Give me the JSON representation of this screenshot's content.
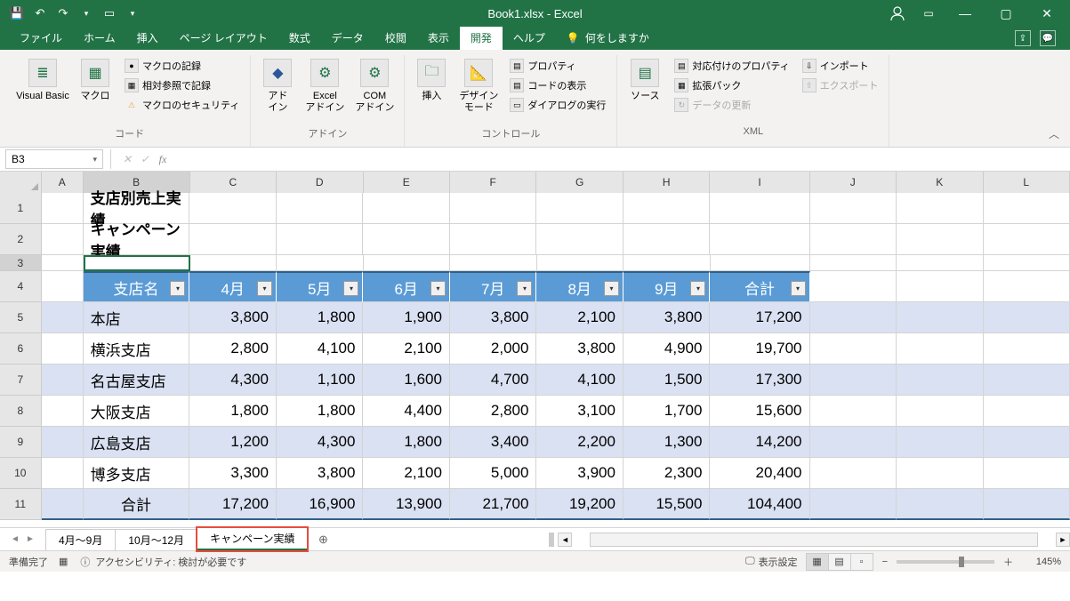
{
  "title": "Book1.xlsx - Excel",
  "tabs": [
    "ファイル",
    "ホーム",
    "挿入",
    "ページ レイアウト",
    "数式",
    "データ",
    "校閲",
    "表示",
    "開発",
    "ヘルプ"
  ],
  "active_tab_index": 8,
  "tell_me": "何をしますか",
  "ribbon": {
    "groups": [
      {
        "label": "コード",
        "big": [
          {
            "label": "Visual Basic"
          },
          {
            "label": "マクロ"
          }
        ],
        "small": [
          "マクロの記録",
          "相対参照で記録",
          "マクロのセキュリティ"
        ]
      },
      {
        "label": "アドイン",
        "big": [
          {
            "label": "アド\nイン"
          },
          {
            "label": "Excel\nアドイン"
          },
          {
            "label": "COM\nアドイン"
          }
        ],
        "small": []
      },
      {
        "label": "コントロール",
        "big": [
          {
            "label": "挿入"
          },
          {
            "label": "デザイン\nモード"
          }
        ],
        "small": [
          "プロパティ",
          "コードの表示",
          "ダイアログの実行"
        ]
      },
      {
        "label": "XML",
        "big": [
          {
            "label": "ソース"
          }
        ],
        "small": [
          "対応付けのプロパティ",
          "拡張パック",
          "データの更新"
        ],
        "small2": [
          "インポート",
          "エクスポート"
        ]
      }
    ]
  },
  "namebox": "B3",
  "formula": "",
  "cols": [
    "A",
    "B",
    "C",
    "D",
    "E",
    "F",
    "G",
    "H",
    "I",
    "J",
    "K",
    "L"
  ],
  "row_nums": [
    1,
    2,
    3,
    4,
    5,
    6,
    7,
    8,
    9,
    10,
    11
  ],
  "title1": "支店別売上実績",
  "title2": "キャンペーン実績",
  "table": {
    "headers": [
      "支店名",
      "4月",
      "5月",
      "6月",
      "7月",
      "8月",
      "9月",
      "合計"
    ],
    "rows": [
      {
        "n": "本店",
        "v": [
          "3,800",
          "1,800",
          "1,900",
          "3,800",
          "2,100",
          "3,800",
          "17,200"
        ]
      },
      {
        "n": "横浜支店",
        "v": [
          "2,800",
          "4,100",
          "2,100",
          "2,000",
          "3,800",
          "4,900",
          "19,700"
        ]
      },
      {
        "n": "名古屋支店",
        "v": [
          "4,300",
          "1,100",
          "1,600",
          "4,700",
          "4,100",
          "1,500",
          "17,300"
        ]
      },
      {
        "n": "大阪支店",
        "v": [
          "1,800",
          "1,800",
          "4,400",
          "2,800",
          "3,100",
          "1,700",
          "15,600"
        ]
      },
      {
        "n": "広島支店",
        "v": [
          "1,200",
          "4,300",
          "1,800",
          "3,400",
          "2,200",
          "1,300",
          "14,200"
        ]
      },
      {
        "n": "博多支店",
        "v": [
          "3,300",
          "3,800",
          "2,100",
          "5,000",
          "3,900",
          "2,300",
          "20,400"
        ]
      }
    ],
    "total": {
      "label": "合計",
      "v": [
        "17,200",
        "16,900",
        "13,900",
        "21,700",
        "19,200",
        "15,500",
        "104,400"
      ]
    }
  },
  "sheets": [
    "4月～9月",
    "10月～12月",
    "キャンペーン実績"
  ],
  "active_sheet": 2,
  "status": {
    "ready": "準備完了",
    "acc": "アクセシビリティ: 検討が必要です",
    "disp": "表示設定",
    "zoom": "145%"
  }
}
